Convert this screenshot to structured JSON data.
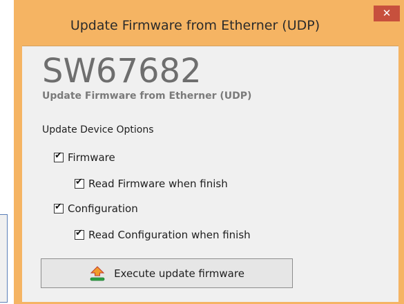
{
  "window": {
    "title": "Update Firmware from Etherner (UDP)",
    "close_glyph": "✕"
  },
  "header": {
    "product_code": "SW67682",
    "subtitle": "Update Firmware from Etherner (UDP)"
  },
  "options": {
    "section_title": "Update Device Options",
    "items": [
      {
        "label": "Firmware",
        "checked": true
      },
      {
        "label": "Read Firmware when finish",
        "checked": true
      },
      {
        "label": "Configuration",
        "checked": true
      },
      {
        "label": "Read Configuration when finish",
        "checked": true
      }
    ]
  },
  "actions": {
    "execute_label": "Execute update firmware",
    "execute_icon": "upload-arrow-icon"
  },
  "colors": {
    "window_frame": "#f5b463",
    "close_button": "#c7503d",
    "client_bg": "#f0f0f0",
    "product_code": "#6e6e6e"
  }
}
